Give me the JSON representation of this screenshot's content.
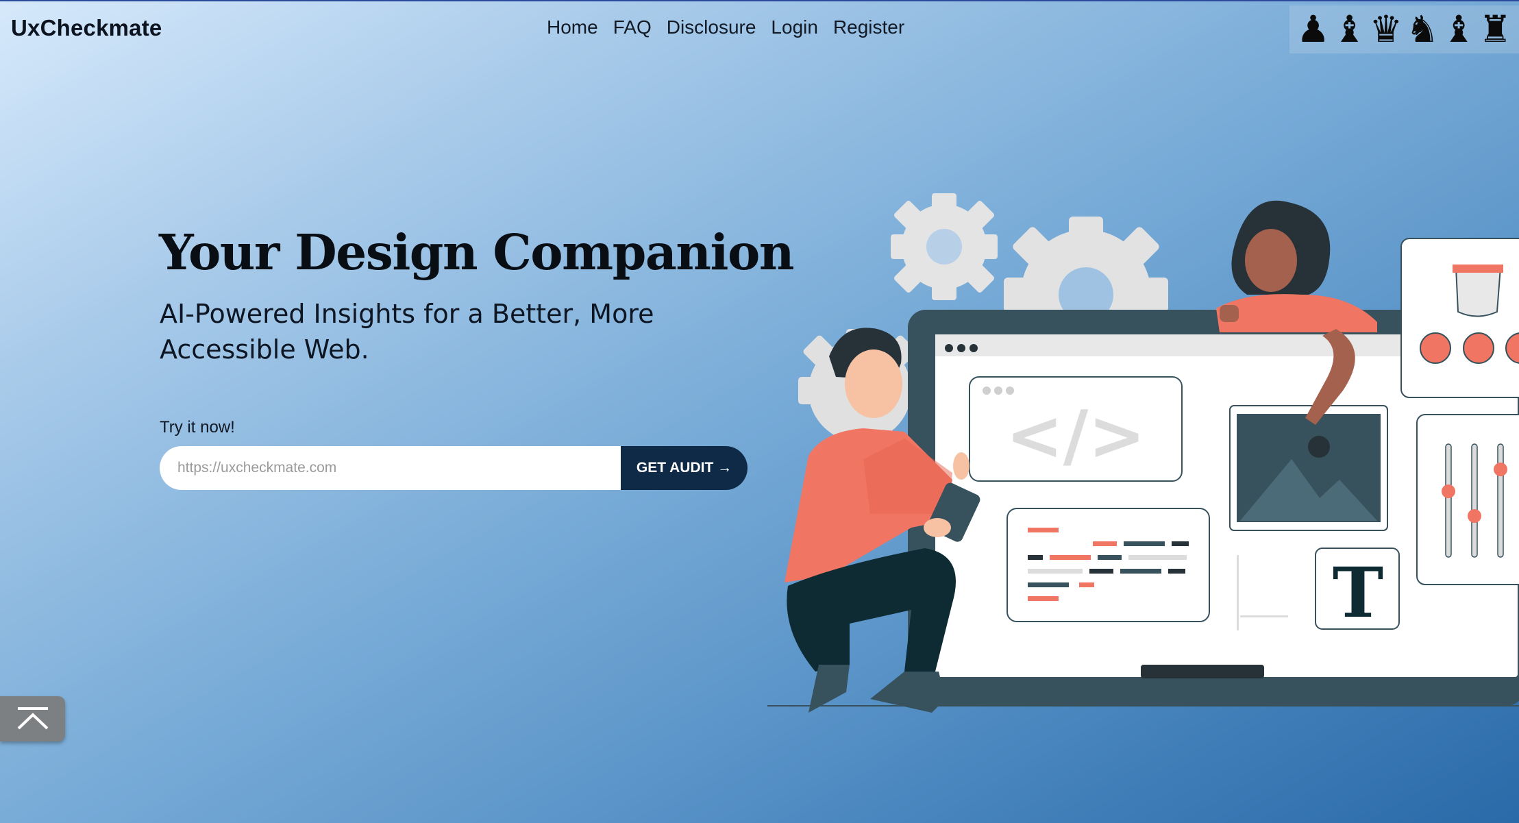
{
  "header": {
    "brand": "UxCheckmate",
    "nav": [
      {
        "label": "Home"
      },
      {
        "label": "FAQ"
      },
      {
        "label": "Disclosure"
      },
      {
        "label": "Login"
      },
      {
        "label": "Register"
      }
    ],
    "chess_pieces": [
      {
        "icon": "chess-pawn-icon",
        "glyph": "♟"
      },
      {
        "icon": "chess-bishop-icon",
        "glyph": "♝"
      },
      {
        "icon": "chess-queen-icon",
        "glyph": "♛"
      },
      {
        "icon": "chess-knight-icon",
        "glyph": "♞"
      },
      {
        "icon": "chess-bishop-icon",
        "glyph": "♝"
      },
      {
        "icon": "chess-rook-icon",
        "glyph": "♜"
      }
    ]
  },
  "hero": {
    "title": "Your Design Companion",
    "subtitle": "AI-Powered Insights for a Better, More Accessible Web.",
    "try_label": "Try it now!",
    "input_placeholder": "https://uxcheckmate.com",
    "button_label": "GET AUDIT →"
  },
  "scroll_top": {
    "icon": "chevron-up-icon"
  },
  "illustration": {
    "code_glyph": "</>",
    "typography_glyph": "T"
  },
  "colors": {
    "accent_dark": "#0e2a47",
    "illustration_coral": "#f07563",
    "illustration_slate": "#37525d"
  }
}
